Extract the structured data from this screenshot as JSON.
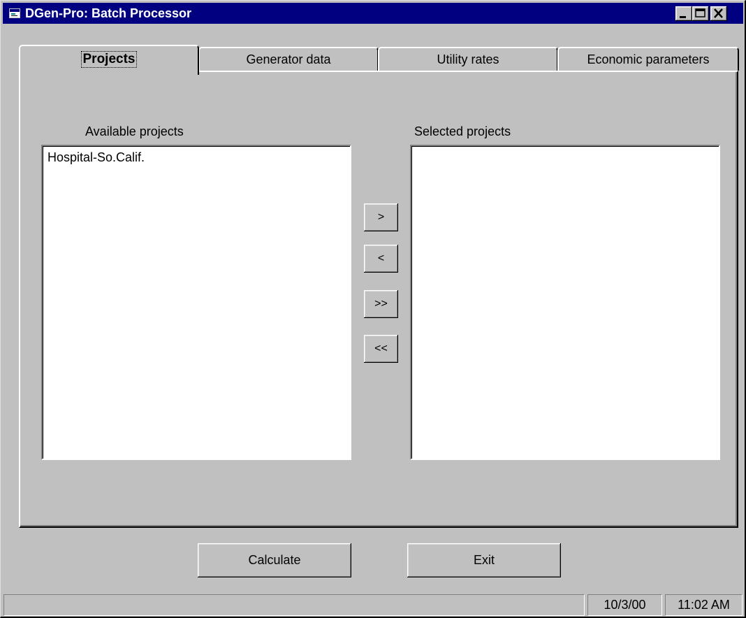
{
  "window": {
    "title": "DGen-Pro: Batch Processor",
    "icon": "app-icon",
    "controls": [
      "minimize",
      "maximize",
      "close"
    ]
  },
  "tabs": [
    {
      "label": "Projects",
      "active": true
    },
    {
      "label": "Generator data",
      "active": false
    },
    {
      "label": "Utility rates",
      "active": false
    },
    {
      "label": "Economic parameters",
      "active": false
    }
  ],
  "projects": {
    "available_label": "Available projects",
    "selected_label": "Selected projects",
    "available_items": [
      "Hospital-So.Calif."
    ],
    "selected_items": [],
    "move_buttons": {
      "add": ">",
      "remove": "<",
      "add_all": ">>",
      "remove_all": "<<"
    }
  },
  "actions": {
    "calculate": "Calculate",
    "exit": "Exit"
  },
  "statusbar": {
    "message": "",
    "date": "10/3/00",
    "time": "11:02 AM"
  },
  "colors": {
    "titlebar": "#000080",
    "face": "#c0c0c0",
    "list_bg": "#ffffff"
  }
}
